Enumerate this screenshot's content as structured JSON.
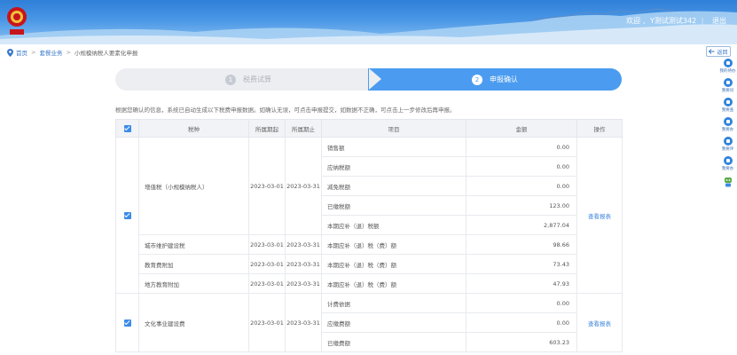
{
  "header": {
    "welcome": "欢迎",
    "user": "Y测试测试342",
    "logout": "退出"
  },
  "breadcrumb": {
    "home": "首页",
    "section": "套餐业务",
    "current": "小规模纳税人要素化申报"
  },
  "back_label": "返回",
  "steps": [
    {
      "num": "1",
      "label": "税费试算"
    },
    {
      "num": "2",
      "label": "申报确认"
    }
  ],
  "hint": "根据您确认的信息，系统已自动生成以下税费申报数据。如确认无误，可点击申报提交，如数据不正确，可点击上一步修改后再申报。",
  "table": {
    "headers": [
      "税种",
      "所属期起",
      "所属期止",
      "项目",
      "金额",
      "操作"
    ],
    "groups": [
      {
        "tax": "增值税（小规模纳税人）",
        "start": "2023-03-01",
        "end": "2023-03-31",
        "action": "查看报表",
        "items": [
          {
            "item": "销售额",
            "amount": "0.00"
          },
          {
            "item": "应纳税额",
            "amount": "0.00"
          },
          {
            "item": "减免税额",
            "amount": "0.00"
          },
          {
            "item": "已缴税额",
            "amount": "123.00"
          },
          {
            "item": "本期应补（退）税额",
            "amount": "2,877.04"
          }
        ]
      },
      {
        "tax": "城市维护建设税",
        "start": "2023-03-01",
        "end": "2023-03-31",
        "items": [
          {
            "item": "本期应补（退）税（费）额",
            "amount": "98.66"
          }
        ]
      },
      {
        "tax": "教育费附加",
        "start": "2023-03-01",
        "end": "2023-03-31",
        "items": [
          {
            "item": "本期应补（退）税（费）额",
            "amount": "73.43"
          }
        ]
      },
      {
        "tax": "地方教育附加",
        "start": "2023-03-01",
        "end": "2023-03-31",
        "items": [
          {
            "item": "本期应补（退）税（费）额",
            "amount": "47.93"
          }
        ]
      },
      {
        "tax": "文化事业建设费",
        "start": "2023-03-01",
        "end": "2023-03-31",
        "action": "查看报表",
        "items": [
          {
            "item": "计费依据",
            "amount": "0.00"
          },
          {
            "item": "应缴费额",
            "amount": "0.00"
          },
          {
            "item": "已缴费额",
            "amount": "603.23"
          }
        ]
      }
    ]
  },
  "dock": [
    {
      "label": "我的待办",
      "icon": "inbox-icon"
    },
    {
      "label": "我要问",
      "icon": "question-icon"
    },
    {
      "label": "我要查",
      "icon": "search-icon"
    },
    {
      "label": "我要办",
      "icon": "task-icon"
    },
    {
      "label": "我要评",
      "icon": "star-icon"
    },
    {
      "label": "我要办",
      "icon": "edit-icon"
    },
    {
      "label": "",
      "icon": "robot-icon"
    }
  ],
  "colors": {
    "accent": "#4b9cf0",
    "link": "#3f86dd",
    "banner": "#2f7fd8"
  }
}
